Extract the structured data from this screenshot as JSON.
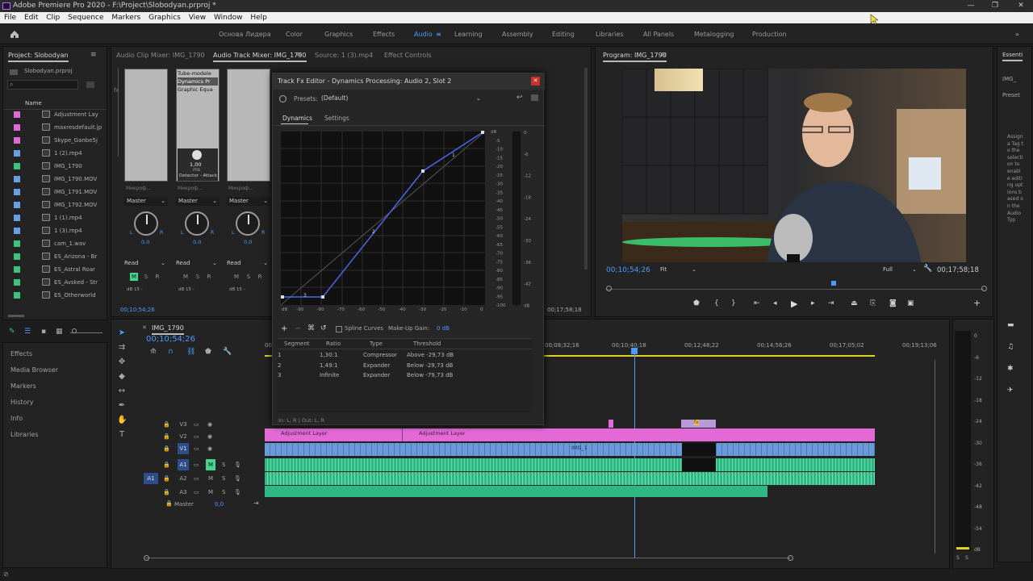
{
  "window": {
    "title": "Adobe Premiere Pro 2020 - F:\\Project\\Slobodyan.prproj *",
    "minimize": "—",
    "restore": "❐",
    "close": "✕"
  },
  "menu": [
    "File",
    "Edit",
    "Clip",
    "Sequence",
    "Markers",
    "Graphics",
    "View",
    "Window",
    "Help"
  ],
  "workspaces": [
    "Основа Лидера",
    "Color",
    "Graphics",
    "Effects",
    "Audio",
    "Learning",
    "Assembly",
    "Editing",
    "Libraries",
    "All Panels",
    "Metalogging",
    "Production"
  ],
  "active_workspace": "Audio",
  "project": {
    "title": "Project: Slobodyan",
    "file": "Slobodyan.prproj",
    "column": "Name",
    "items": [
      {
        "name": "Adjustment Lay",
        "color": "#e36ad6"
      },
      {
        "name": "maxresdefault.jp",
        "color": "#e36ad6"
      },
      {
        "name": "Skype_Ganbe5j",
        "color": "#e36ad6"
      },
      {
        "name": "1 (2).mp4",
        "color": "#6aa0e3"
      },
      {
        "name": "IMG_1790",
        "color": "#3ec27b"
      },
      {
        "name": "IMG_1790.MOV",
        "color": "#6aa0e3"
      },
      {
        "name": "IMG_1791.MOV",
        "color": "#6aa0e3"
      },
      {
        "name": "IMG_1792.MOV",
        "color": "#6aa0e3"
      },
      {
        "name": "1 (1).mp4",
        "color": "#6aa0e3"
      },
      {
        "name": "1 (3).mp4",
        "color": "#6aa0e3"
      },
      {
        "name": "cam_1.wav",
        "color": "#3ec27b"
      },
      {
        "name": "ES_Arizona - Br",
        "color": "#3ec27b"
      },
      {
        "name": "ES_Astral Roar",
        "color": "#3ec27b"
      },
      {
        "name": "ES_Avsked - Str",
        "color": "#3ec27b"
      },
      {
        "name": "ES_Otherworld",
        "color": "#3ec27b"
      }
    ]
  },
  "left_panels": [
    "Effects",
    "Media Browser",
    "Markers",
    "History",
    "Info",
    "Libraries"
  ],
  "mixer": {
    "tabs": [
      "Audio Clip Mixer: IMG_1790",
      "Audio Track Mixer: IMG_1790",
      "Source: 1 (3).mp4",
      "Effect Controls"
    ],
    "slot_items": [
      "Tube-modele",
      "Dynamics Pr",
      "Graphic Equa"
    ],
    "slot_value": "1,00",
    "slot_unit": "ms",
    "slot_label": "Detector - Attack",
    "fader_label": "Микроф...",
    "channels": [
      {
        "output": "Master",
        "pan": "0,0",
        "mode": "Read"
      },
      {
        "output": "Master",
        "pan": "0,0",
        "mode": "Read"
      },
      {
        "output": "Master",
        "pan": "0,0",
        "mode": "Read"
      }
    ],
    "L": "L",
    "R": "R",
    "M": "M",
    "S": "S",
    "Rr": "R",
    "db": "dB 15 -",
    "timecode": "00;10;54;26"
  },
  "dialog": {
    "title": "Track Fx Editor - Dynamics Processing: Audio 2, Slot 2",
    "presets_label": "Presets:",
    "preset_value": "(Default)",
    "tabs": [
      "Dynamics",
      "Settings"
    ],
    "x_ticks": [
      "dB",
      "-90",
      "-80",
      "-70",
      "-60",
      "-50",
      "-40",
      "-30",
      "-20",
      "-10",
      "0"
    ],
    "y_ticks": [
      "dB",
      "-5",
      "-10",
      "-15",
      "-20",
      "-25",
      "-30",
      "-35",
      "-40",
      "-45",
      "-50",
      "-55",
      "-60",
      "-65",
      "-70",
      "-75",
      "-80",
      "-85",
      "-90",
      "-95",
      "-100"
    ],
    "meter_ticks": [
      "0",
      "-6",
      "-12",
      "-18",
      "-24",
      "-30",
      "-36",
      "-42",
      "dB"
    ],
    "point_labels": [
      "1",
      "2",
      "3"
    ],
    "spline": "Spline Curves",
    "makeup_label": "Make-Up Gain:",
    "makeup_value": "0 dB",
    "table_headers": [
      "Segment",
      "Ratio",
      "Type",
      "Threshold"
    ],
    "segments": [
      {
        "seg": "1",
        "ratio": "1,30:1",
        "type": "Compressor",
        "threshold": "Above -29,73 dB"
      },
      {
        "seg": "2",
        "ratio": "1,49:1",
        "type": "Expander",
        "threshold": "Below -29,73 dB"
      },
      {
        "seg": "3",
        "ratio": "Infinite",
        "type": "Expander",
        "threshold": "Below -79,73 dB"
      }
    ],
    "footer": "In: L, R | Out: L, R"
  },
  "program": {
    "title": "Program: IMG_1790",
    "timecode": "00;10;54;26",
    "fit": "Fit",
    "quality": "Full",
    "duration": "00;17;58;18"
  },
  "essentials": {
    "tab": "Essenti",
    "field1": "IMG_",
    "field2": "Preset",
    "text": "Assign a Tag to the selection to enable editing options based on the Audio Typ"
  },
  "timeline": {
    "tab": "IMG_1790",
    "timecode": "00;10;54;26",
    "ruler": [
      "00",
      "00;08;32;16",
      "00;10;40;18",
      "00;12;48;22",
      "00;14;56;26",
      "00;17;05;02",
      "00;19;13;06"
    ],
    "tracks": [
      "V3",
      "V2",
      "V1",
      "A1",
      "A2",
      "A3"
    ],
    "master": "Master",
    "master_val": "0,0",
    "src_a1": "A1",
    "clip_labels": [
      "Adjustment Layer",
      "Adjustment Layer",
      "IMG_1"
    ],
    "fx_badge": "fx"
  },
  "meter_db": [
    "0",
    "-6",
    "-12",
    "-18",
    "-24",
    "-30",
    "-36",
    "-42",
    "-48",
    "-54",
    "dB"
  ],
  "meter_ss": [
    "S",
    "S"
  ],
  "mini_time": "00;17;58;18",
  "colors": {
    "accent": "#4b9bff",
    "pink": "#e36ad6",
    "video": "#6a9bd8",
    "audio": "#2fb884",
    "mute_green": "#47d28d"
  }
}
